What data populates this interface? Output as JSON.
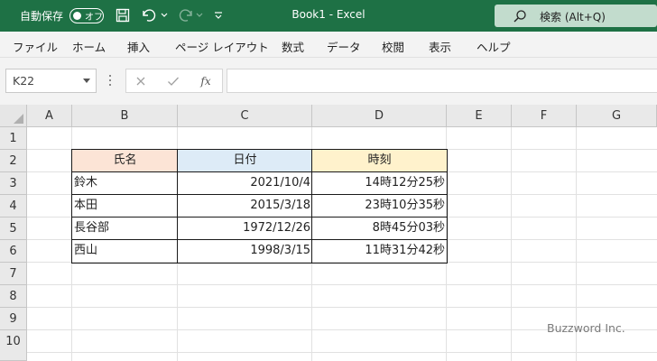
{
  "titlebar": {
    "autosave_label": "自動保存",
    "autosave_toggle": "オフ",
    "title": "Book1  -  Excel",
    "search_placeholder": "検索 (Alt+Q)"
  },
  "menu": [
    "ファイル",
    "ホーム",
    "挿入",
    "ページ レイアウト",
    "数式",
    "データ",
    "校閲",
    "表示",
    "ヘルプ"
  ],
  "formula_bar": {
    "name_box": "K22",
    "fx_label": "fx",
    "formula": ""
  },
  "columns": [
    "A",
    "B",
    "C",
    "D",
    "E",
    "F",
    "G"
  ],
  "rows": [
    "1",
    "2",
    "3",
    "4",
    "5",
    "6",
    "7",
    "8",
    "9",
    "10"
  ],
  "table": {
    "headers": [
      "氏名",
      "日付",
      "時刻"
    ],
    "header_colors": [
      "#fce4d6",
      "#ddebf7",
      "#fff2cc"
    ],
    "rows": [
      [
        "鈴木",
        "2021/10/4",
        "14時12分25秒"
      ],
      [
        "本田",
        "2015/3/18",
        "23時10分35秒"
      ],
      [
        "長谷部",
        "1972/12/26",
        "8時45分03秒"
      ],
      [
        "西山",
        "1998/3/15",
        "11時31分42秒"
      ]
    ]
  },
  "watermark": "Buzzword Inc.",
  "colors": {
    "titlebar": "#1e7145",
    "ribbon": "#f3f3f3"
  }
}
